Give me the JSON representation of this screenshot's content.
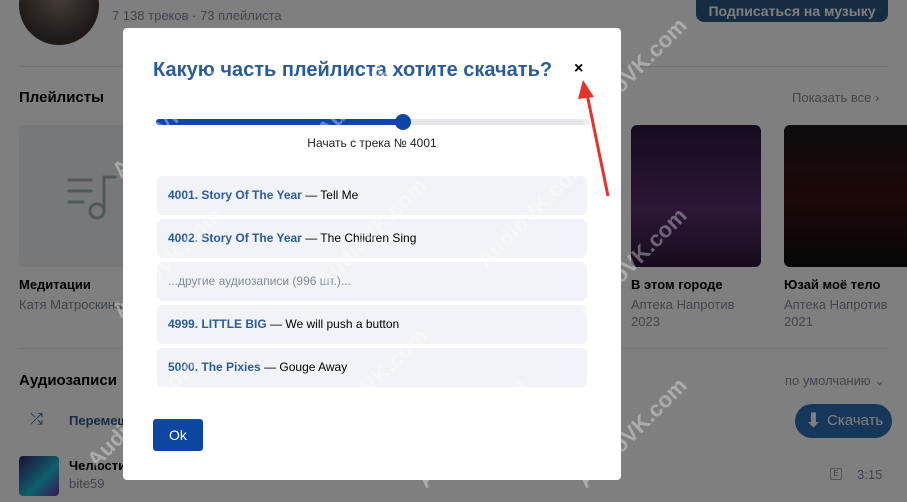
{
  "profile": {
    "stats": "7 138 треков · 73 плейлиста",
    "subscribe_label": "Подписаться на музыку"
  },
  "playlists_section": {
    "title": "Плейлисты",
    "show_all": "Показать все",
    "chevron": "›",
    "items": [
      {
        "title": "Медитации",
        "author": "Катя Матроскина",
        "year": ""
      },
      {
        "title": "В этом городе",
        "author": "Аптека Напротив",
        "year": "2023"
      },
      {
        "title": "Юзай моё тело",
        "author": "Аптека Напротив",
        "year": "2021"
      }
    ]
  },
  "audio_section": {
    "title": "Аудиозаписи",
    "sort_label": "по умолчанию",
    "sort_chevron": "⌄",
    "shuffle_icon": "⤮",
    "shuffle_label": "Перемеш",
    "download_label": "Скачать",
    "download_icon": "⬇",
    "track": {
      "title": "Челюсти",
      "artist": "bite59",
      "duration": "3:15",
      "badge": "E"
    }
  },
  "modal": {
    "title": "Какую часть плейлиста хотите скачать?",
    "close_icon": "×",
    "slider_fraction": 0.57,
    "caption": "Начать с трека № 4001",
    "rows": [
      {
        "name": "4001. Story Of The Year",
        "rest": " — Tell Me"
      },
      {
        "name": "4002. Story Of The Year",
        "rest": " — The Children Sing"
      },
      {
        "muted": "...другие аудиозаписи (996 шт.)..."
      },
      {
        "name": "4999. LITTLE BIG",
        "rest": " — We will push a button"
      },
      {
        "name": "5000. The Pixies",
        "rest": " — Gouge Away"
      }
    ],
    "ok_label": "Ok"
  },
  "watermark": "AudioVK.com",
  "colors": {
    "accent": "#0d47a1",
    "link": "#2b5c9a",
    "annotation_arrow": "#e5322d"
  }
}
